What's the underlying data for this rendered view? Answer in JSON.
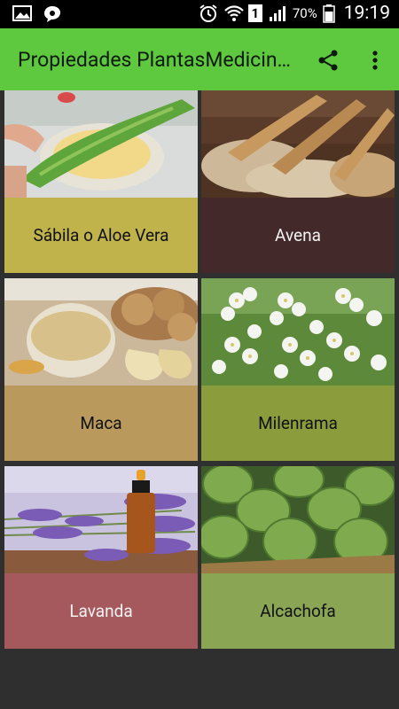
{
  "status_bar": {
    "battery_percent": "70%",
    "time": "19:19",
    "sim_slot": "1",
    "icons": [
      "image-icon",
      "chat-icon",
      "alarm-icon",
      "wifi-icon",
      "sim-icon",
      "signal-icon",
      "battery-icon"
    ]
  },
  "app_bar": {
    "title": "Propiedades PlantasMedicinales",
    "actions": [
      "share-icon",
      "more-options-icon"
    ]
  },
  "plants": [
    {
      "name": "Sábila o Aloe Vera",
      "label_color": "#c1b34b",
      "text_light": false,
      "image": "aloe-vera-photo"
    },
    {
      "name": "Avena",
      "label_color": "#43292a",
      "text_light": true,
      "image": "oats-photo"
    },
    {
      "name": "Maca",
      "label_color": "#ba9a5c",
      "text_light": false,
      "image": "maca-photo"
    },
    {
      "name": "Milenrama",
      "label_color": "#8b9c3d",
      "text_light": false,
      "image": "yarrow-photo"
    },
    {
      "name": "Lavanda",
      "label_color": "#a6595c",
      "text_light": true,
      "image": "lavender-photo"
    },
    {
      "name": "Alcachofa",
      "label_color": "#8aa654",
      "text_light": false,
      "image": "artichoke-photo"
    }
  ]
}
